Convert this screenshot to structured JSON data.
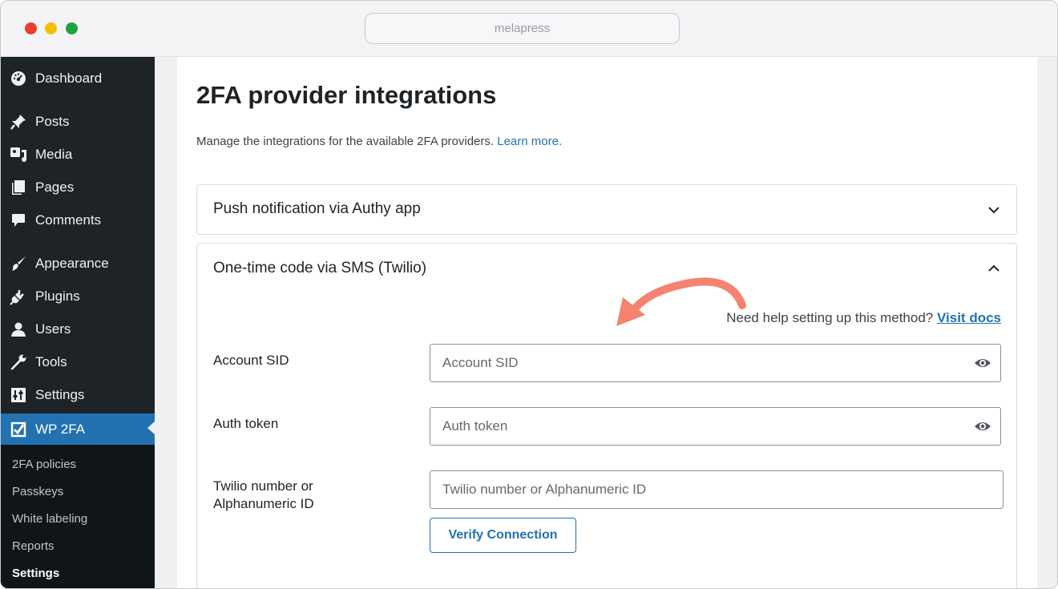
{
  "browser": {
    "url": "melapress"
  },
  "sidebar": {
    "items": [
      {
        "label": "Dashboard",
        "icon": "dashboard-icon"
      },
      {
        "label": "Posts",
        "icon": "pin-icon"
      },
      {
        "label": "Media",
        "icon": "media-icon"
      },
      {
        "label": "Pages",
        "icon": "pages-icon"
      },
      {
        "label": "Comments",
        "icon": "comment-icon"
      },
      {
        "label": "Appearance",
        "icon": "brush-icon"
      },
      {
        "label": "Plugins",
        "icon": "plug-icon"
      },
      {
        "label": "Users",
        "icon": "user-icon"
      },
      {
        "label": "Tools",
        "icon": "wrench-icon"
      },
      {
        "label": "Settings",
        "icon": "sliders-icon"
      },
      {
        "label": "WP 2FA",
        "icon": "wp2fa-icon",
        "active": true
      }
    ],
    "submenu": [
      {
        "label": "2FA policies"
      },
      {
        "label": "Passkeys"
      },
      {
        "label": "White labeling"
      },
      {
        "label": "Reports"
      },
      {
        "label": "Settings",
        "current": true
      }
    ]
  },
  "main": {
    "title": "2FA provider integrations",
    "description": "Manage the integrations for the available 2FA providers.",
    "learn_more": "Learn more.",
    "panels": [
      {
        "title": "Push notification via Authy app",
        "expanded": false
      },
      {
        "title": "One-time code via SMS (Twilio)",
        "expanded": true
      }
    ],
    "twilio": {
      "help_text": "Need help setting up this method?",
      "help_link": "Visit docs",
      "fields": [
        {
          "label": "Account SID",
          "placeholder": "Account SID",
          "value": ""
        },
        {
          "label": "Auth token",
          "placeholder": "Auth token",
          "value": ""
        },
        {
          "label": "Twilio number or Alphanumeric ID",
          "placeholder": "Twilio number or Alphanumeric ID",
          "value": ""
        }
      ],
      "verify_button": "Verify Connection"
    }
  },
  "colors": {
    "sidebar_bg": "#1d2327",
    "accent": "#2271b1",
    "annotation_arrow": "#f4836f"
  }
}
